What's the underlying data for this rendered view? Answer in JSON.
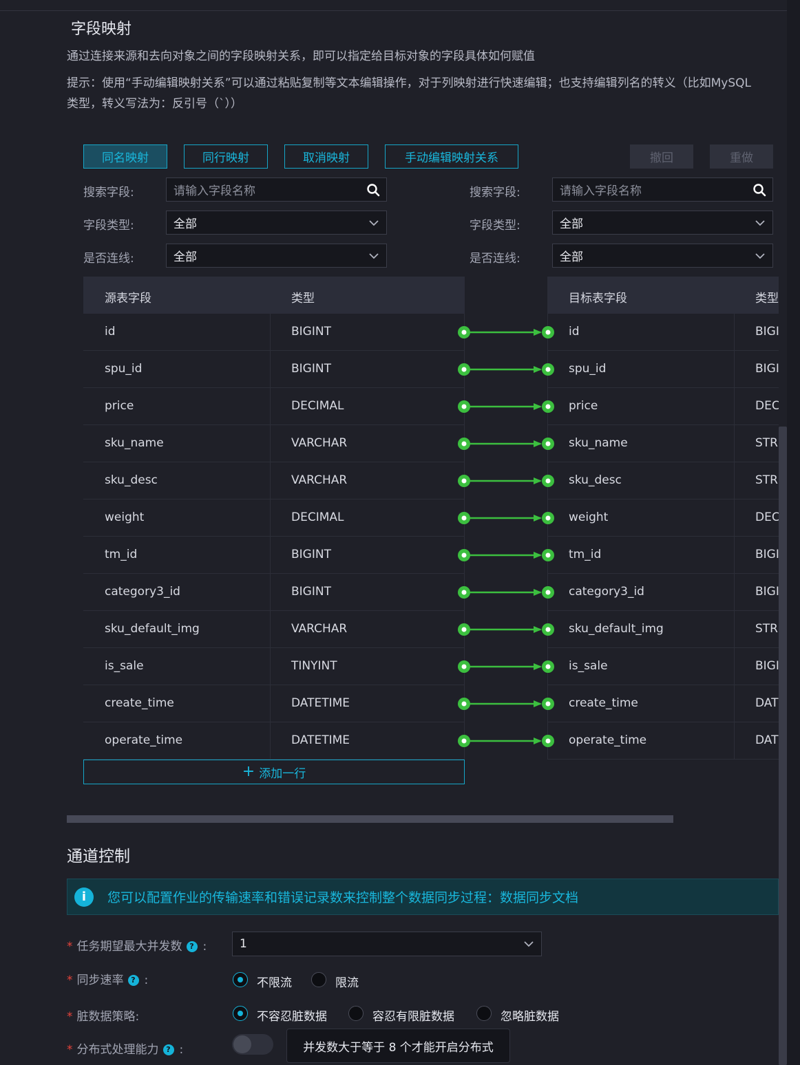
{
  "mapping": {
    "title": "字段映射",
    "desc": "通过连接来源和去向对象之间的字段映射关系，即可以指定给目标对象的字段具体如何赋值",
    "tip_line1": "提示：使用“手动编辑映射关系”可以通过粘贴复制等文本编辑操作，对于列映射进行快速编辑；也支持编辑列名的转义（比如MySQL",
    "tip_line2": "类型，转义写法为：反引号（`））",
    "buttons": {
      "same_name": "同名映射",
      "same_row": "同行映射",
      "cancel": "取消映射",
      "manual": "手动编辑映射关系",
      "undo": "撤回",
      "redo": "重做"
    },
    "filters": {
      "search_label": "搜索字段:",
      "search_placeholder": "请输入字段名称",
      "type_label": "字段类型:",
      "type_value": "全部",
      "linked_label": "是否连线:",
      "linked_value": "全部"
    },
    "source_headers": [
      "源表字段",
      "类型"
    ],
    "target_headers": [
      "目标表字段",
      "类型"
    ],
    "rows": [
      {
        "src": "id",
        "src_type": "BIGINT",
        "dst": "id",
        "dst_type": "BIGI"
      },
      {
        "src": "spu_id",
        "src_type": "BIGINT",
        "dst": "spu_id",
        "dst_type": "BIGI"
      },
      {
        "src": "price",
        "src_type": "DECIMAL",
        "dst": "price",
        "dst_type": "DEC"
      },
      {
        "src": "sku_name",
        "src_type": "VARCHAR",
        "dst": "sku_name",
        "dst_type": "STRI"
      },
      {
        "src": "sku_desc",
        "src_type": "VARCHAR",
        "dst": "sku_desc",
        "dst_type": "STRI"
      },
      {
        "src": "weight",
        "src_type": "DECIMAL",
        "dst": "weight",
        "dst_type": "DEC"
      },
      {
        "src": "tm_id",
        "src_type": "BIGINT",
        "dst": "tm_id",
        "dst_type": "BIGI"
      },
      {
        "src": "category3_id",
        "src_type": "BIGINT",
        "dst": "category3_id",
        "dst_type": "BIGI"
      },
      {
        "src": "sku_default_img",
        "src_type": "VARCHAR",
        "dst": "sku_default_img",
        "dst_type": "STRI"
      },
      {
        "src": "is_sale",
        "src_type": "TINYINT",
        "dst": "is_sale",
        "dst_type": "BIGI"
      },
      {
        "src": "create_time",
        "src_type": "DATETIME",
        "dst": "create_time",
        "dst_type": "DATI"
      },
      {
        "src": "operate_time",
        "src_type": "DATETIME",
        "dst": "operate_time",
        "dst_type": "DATI"
      }
    ],
    "add_row": "添加一行"
  },
  "channel": {
    "title": "通道控制",
    "info": "您可以配置作业的传输速率和错误记录数来控制整个数据同步过程：数据同步文档",
    "concurrency_label": "任务期望最大并发数",
    "concurrency_value": "1",
    "speed_label": "同步速率",
    "speed_options": [
      "不限流",
      "限流"
    ],
    "dirty_label": "脏数据策略:",
    "dirty_options": [
      "不容忍脏数据",
      "容忍有限脏数据",
      "忽略脏数据"
    ],
    "distributed_label": "分布式处理能力",
    "distributed_tooltip": "并发数大于等于 8 个才能开启分布式"
  },
  "colors": {
    "accent": "#19b7dc",
    "link": "#3cbf3f",
    "required": "#e5433a"
  }
}
